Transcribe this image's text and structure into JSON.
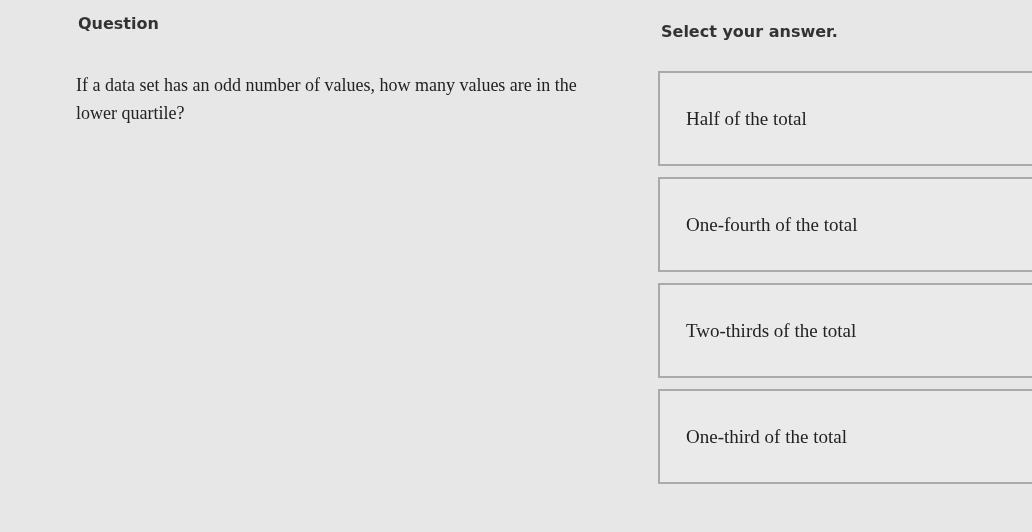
{
  "question": {
    "heading": "Question",
    "text": "If a data set has an odd number of values, how many values are in the lower quartile?"
  },
  "answers": {
    "heading": "Select your answer.",
    "options": [
      {
        "label": "Half of the total"
      },
      {
        "label": "One-fourth of the total"
      },
      {
        "label": "Two-thirds of the total"
      },
      {
        "label": "One-third of the total"
      }
    ]
  }
}
